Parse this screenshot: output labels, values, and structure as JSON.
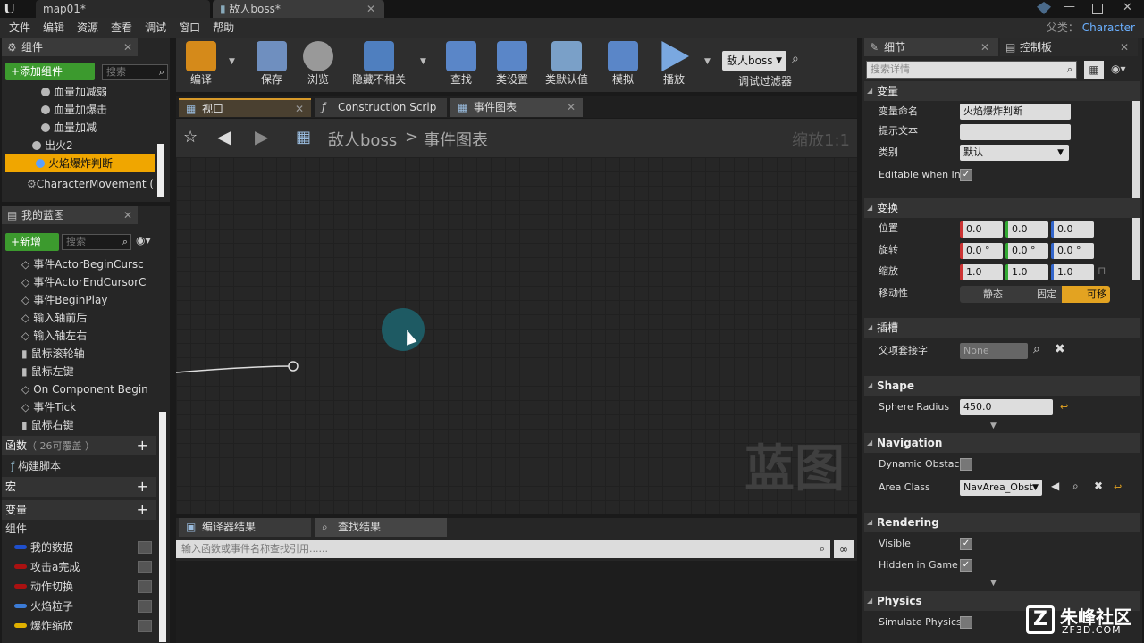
{
  "titlebar": {
    "tabs": [
      {
        "label": "map01*"
      },
      {
        "label": "敌人boss*"
      }
    ],
    "parent_label": "父类：",
    "parent_value": "Character"
  },
  "menu": [
    "文件",
    "编辑",
    "资源",
    "查看",
    "调试",
    "窗口",
    "帮助"
  ],
  "components_panel": {
    "title": "组件",
    "add_button": "+添加组件",
    "search_placeholder": "搜索",
    "items": [
      "血量加减弱",
      "血量加爆击",
      "血量加减",
      "出火2",
      "火焰爆炸判断",
      "CharacterMovement (继"
    ]
  },
  "blueprint_panel": {
    "title": "我的蓝图",
    "new_button": "+新增",
    "search_placeholder": "搜索",
    "events": [
      "事件ActorBeginCursc",
      "事件ActorEndCursorC",
      "事件BeginPlay",
      "输入轴前后",
      "输入轴左右",
      "鼠标滚轮轴",
      "鼠标左键",
      "On Component Begin",
      "事件Tick",
      "鼠标右键"
    ],
    "functions_label": "函数",
    "functions_note": "（ 26可覆盖 ）",
    "construct": "构建脚本",
    "macros": "宏",
    "variables": "变量",
    "components": "组件",
    "vars": [
      {
        "name": "我的数据",
        "color": "#1f4fcc"
      },
      {
        "name": "攻击a完成",
        "color": "#aa1111"
      },
      {
        "name": "动作切换",
        "color": "#aa1111"
      },
      {
        "name": "火焰粒子",
        "color": "#3b7bd6"
      },
      {
        "name": "爆炸缩放",
        "color": "#e0b000"
      }
    ]
  },
  "toolbar": {
    "tools": [
      "编译",
      "保存",
      "浏览",
      "隐藏不相关",
      "查找",
      "类设置",
      "类默认值",
      "模拟",
      "播放"
    ],
    "debug_select": "敌人boss",
    "debug_label": "调试过滤器"
  },
  "editor_tabs": [
    "视口",
    "Construction Scrip",
    "事件图表"
  ],
  "graph": {
    "breadcrumb_root": "敌人boss",
    "breadcrumb_sep": ">",
    "breadcrumb_leaf": "事件图表",
    "zoom": "缩放1:1",
    "watermark": "蓝图"
  },
  "bottom_tabs": [
    "编译器结果",
    "查找结果"
  ],
  "find_placeholder": "输入函数或事件名称查找引用......",
  "details": {
    "tab1": "细节",
    "tab2": "控制板",
    "search_placeholder": "搜索详情",
    "var_section": "变量",
    "var_name_label": "变量命名",
    "var_name_value": "火焰爆炸判断",
    "tooltip_label": "提示文本",
    "category_label": "类别",
    "category_value": "默认",
    "editable_label": "Editable when Inh",
    "transform_section": "变换",
    "location_label": "位置",
    "rotation_label": "旋转",
    "scale_label": "缩放",
    "mobility_label": "移动性",
    "location": [
      "0.0",
      "0.0",
      "0.0"
    ],
    "rotation": [
      "0.0 °",
      "0.0 °",
      "0.0 °"
    ],
    "scale": [
      "1.0",
      "1.0",
      "1.0"
    ],
    "mobility": [
      "静态",
      "固定",
      "可移"
    ],
    "socket_section": "插槽",
    "parent_socket_label": "父项套接字",
    "parent_socket_value": "None",
    "shape_section": "Shape",
    "sphere_radius_label": "Sphere Radius",
    "sphere_radius_value": "450.0",
    "nav_section": "Navigation",
    "dynamic_obstacle_label": "Dynamic Obstacl",
    "area_class_label": "Area Class",
    "area_class_value": "NavArea_Obst",
    "render_section": "Rendering",
    "visible_label": "Visible",
    "hidden_label": "Hidden in Game",
    "physics_section": "Physics",
    "simulate_label": "Simulate Physics"
  },
  "watermark": {
    "brand": "朱峰社区",
    "url": "ZF3D.COM"
  }
}
